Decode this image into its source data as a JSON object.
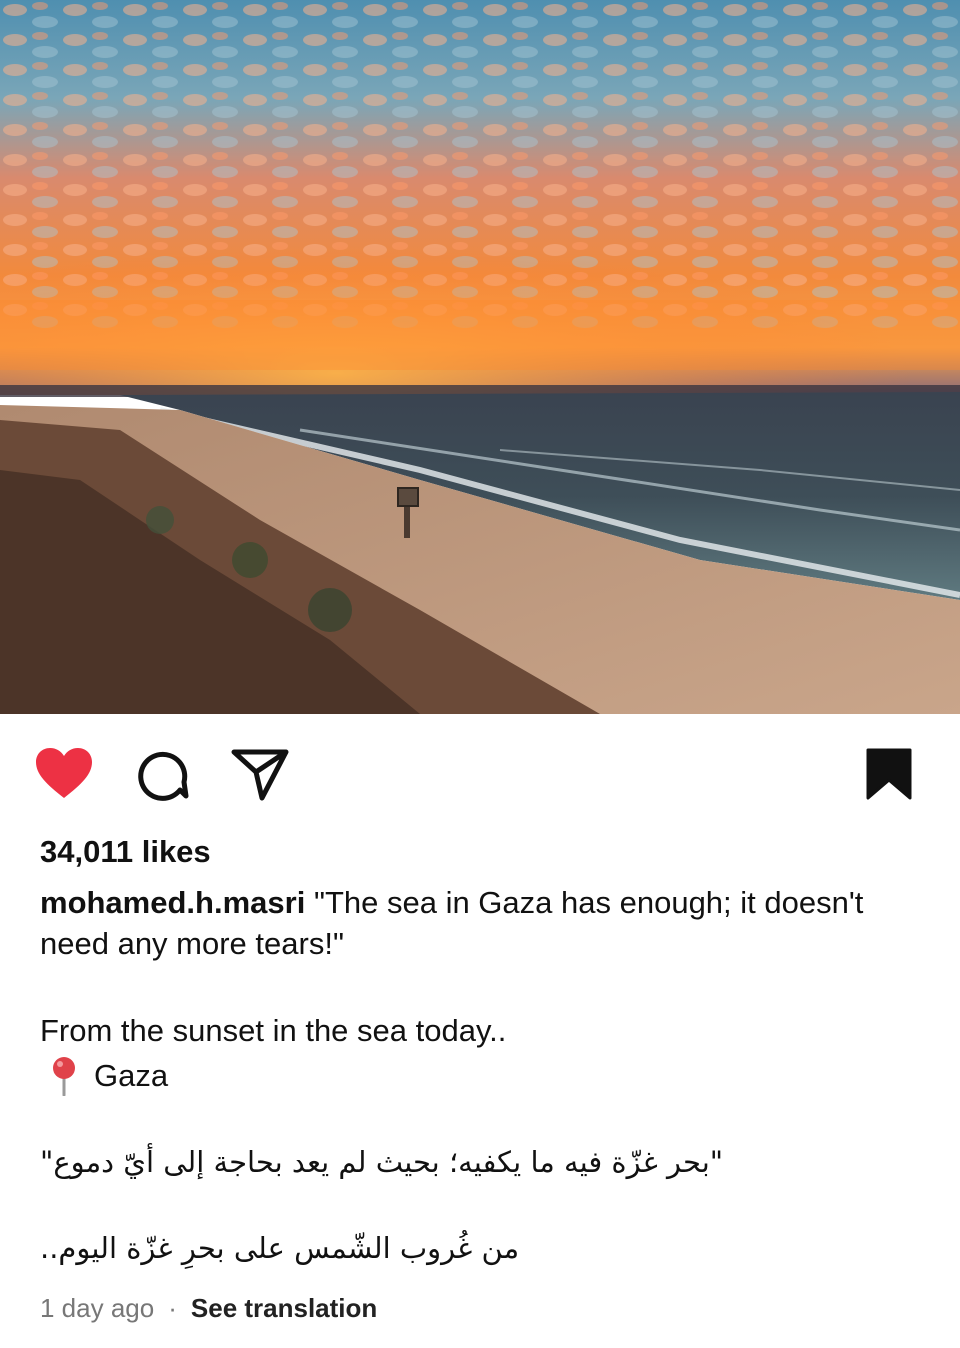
{
  "post": {
    "image_alt": "",
    "colors": {
      "heart": "#ed3144",
      "text": "#111111",
      "muted": "#777777"
    },
    "actions": {
      "like_icon": "heart-filled-icon",
      "comment_icon": "comment-bubble-icon",
      "share_icon": "paper-plane-icon",
      "save_icon": "bookmark-filled-icon"
    },
    "likes_text": "34,011 likes",
    "username": "mohamed.h.masri",
    "caption_en_quote": "\"The sea in Gaza has enough; it doesn't need any more tears!\"",
    "caption_en_line2": "From the sunset in the sea today..",
    "location_icon": "round-pushpin-icon",
    "location": "Gaza",
    "caption_ar_quote": "\"بحر غزّة فيه ما يكفيه؛ بحيث لم يعد بحاجة إلى أيّ دموع\"",
    "caption_ar_line2": "من غُروب الشّمس على بحرِ غزّة اليوم..",
    "time_ago": "1 day ago",
    "separator": "·",
    "see_translation": "See translation"
  }
}
